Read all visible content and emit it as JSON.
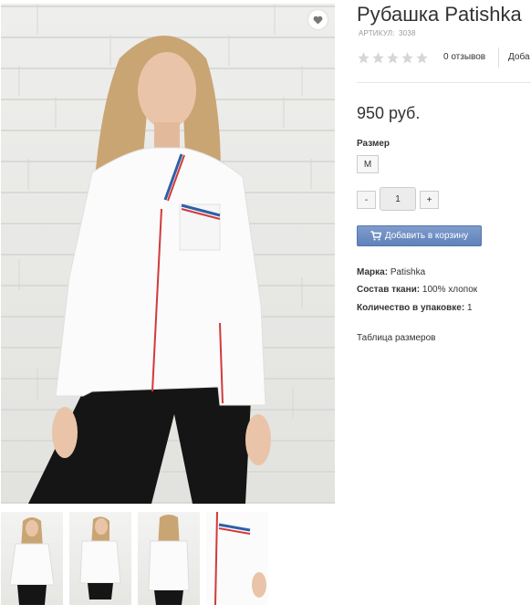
{
  "product": {
    "title": "Рубашка Patishka",
    "sku_label": "АРТИКУЛ:",
    "sku_value": "3038",
    "reviews_text": "0 отзывов",
    "add_review_text": "Доба",
    "rating": 0,
    "rating_max": 5,
    "price": "950 руб.",
    "size_label": "Размер",
    "size_option": "M",
    "qty_minus": "-",
    "qty_value": "1",
    "qty_plus": "+",
    "cart_button": "Добавить в корзину",
    "attributes": [
      {
        "name": "Марка:",
        "value": "Patishka"
      },
      {
        "name": "Состав ткани:",
        "value": "100% хлопок"
      },
      {
        "name": "Количество в упаковке:",
        "value": "1"
      }
    ],
    "size_table_link": "Таблица размеров"
  },
  "gallery": {
    "thumbnails": [
      {
        "icon": "model-front-thumbnail"
      },
      {
        "icon": "model-side-thumbnail"
      },
      {
        "icon": "model-back-thumbnail"
      },
      {
        "icon": "shirt-detail-thumbnail"
      }
    ],
    "favorite_icon": "heart-icon"
  },
  "colors": {
    "accent_button": "#6a8bc2",
    "text": "#333333",
    "muted": "#999999",
    "star_empty": "#d6d6d6"
  }
}
